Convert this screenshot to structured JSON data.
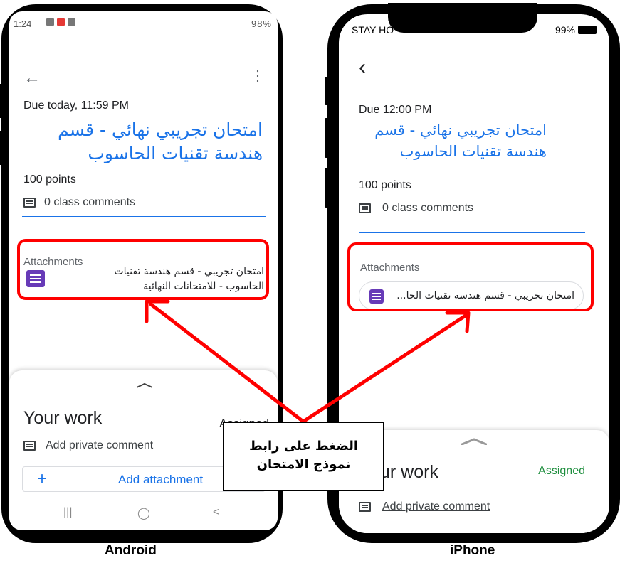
{
  "android": {
    "status_time": "1:24",
    "status_right": "98%",
    "due": "Due today, 11:59 PM",
    "title": "امتحان تجريبي نهائي - قسم هندسة تقنيات الحاسوب",
    "points": "100 points",
    "comments": "0 class comments",
    "attachments_label": "Attachments",
    "attachment_text": "امتحان تجريبي - قسم هندسة تقنيات الحاسوب - للامتحانات النهائية",
    "your_work": "Your work",
    "assigned": "Assigned",
    "private_comment": "Add private comment",
    "add_attachment": "Add attachment",
    "nav_recents": "|||",
    "nav_home": "◯",
    "nav_back": "<"
  },
  "iphone": {
    "status_left": "STAY HO",
    "status_right": "99%",
    "due": "Due 12:00 PM",
    "title": "امتحان تجريبي نهائي - قسم هندسة تقنيات الحاسوب",
    "points": "100 points",
    "comments": "0 class comments",
    "attachments_label": "Attachments",
    "attachment_chip": "امتحان تجريبي - قسم هندسة تقنيات الحا...",
    "your_work": "ur work",
    "assigned": "Assigned",
    "private_comment": "Add private comment"
  },
  "callout": {
    "line1": "الضغط على رابط",
    "line2": "نموذج الامتحان"
  },
  "captions": {
    "android": "Android",
    "iphone": "iPhone"
  },
  "colors": {
    "accent": "#1a73e8",
    "highlight": "#ff0000",
    "forms_purple": "#673ab7",
    "assigned_green": "#1e8e3e"
  },
  "icons": {
    "comment": "comment-icon",
    "forms": "forms-icon",
    "back": "back-arrow-icon",
    "more": "more-vert-icon",
    "caret": "chevron-up-icon"
  }
}
